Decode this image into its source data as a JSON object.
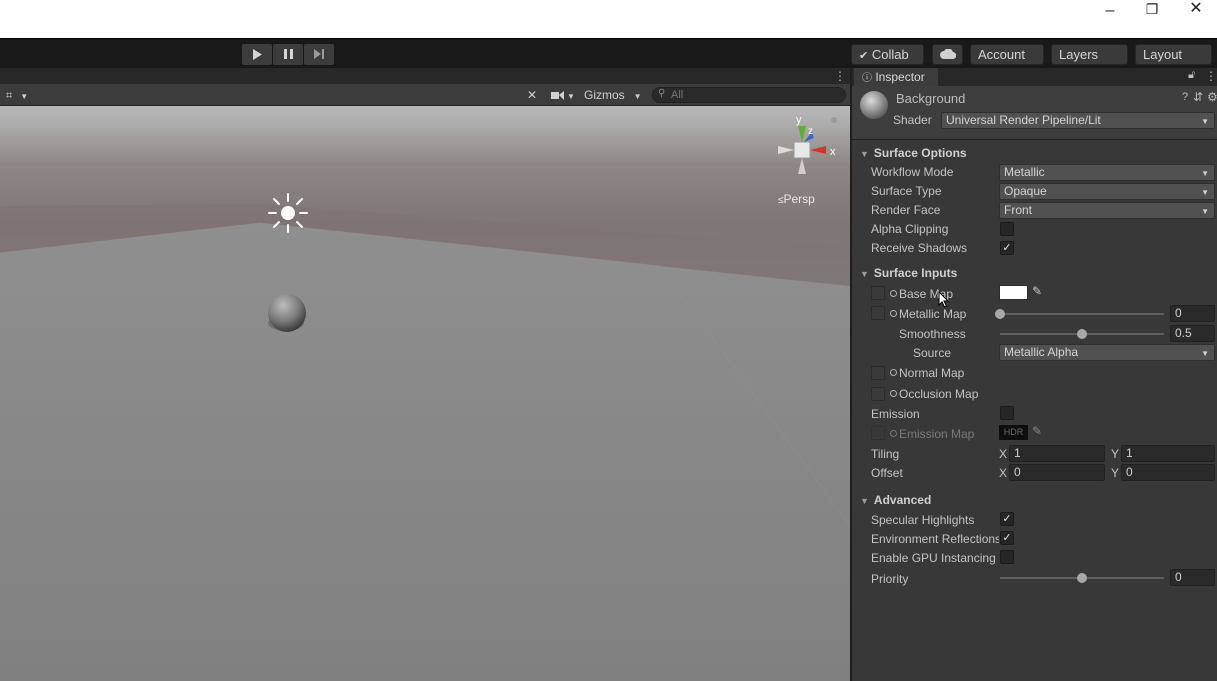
{
  "window_controls": {
    "minimize": "–",
    "restore": "❐",
    "close": "✕"
  },
  "toolbar": {
    "collab_label": "Collab",
    "account_label": "Account",
    "layers_label": "Layers",
    "layout_label": "Layout"
  },
  "scene": {
    "toolbar": {
      "gizmos_label": "Gizmos",
      "search_placeholder": "All"
    },
    "persp_label": "Persp",
    "gizmo_axes": {
      "y": "y",
      "z": "z",
      "x": "x"
    }
  },
  "inspector": {
    "tab_label": "Inspector",
    "material_name": "Background",
    "shader_label": "Shader",
    "shader_value": "Universal Render Pipeline/Lit",
    "surface_options": {
      "title": "Surface Options",
      "workflow_mode_label": "Workflow Mode",
      "workflow_mode_value": "Metallic",
      "surface_type_label": "Surface Type",
      "surface_type_value": "Opaque",
      "render_face_label": "Render Face",
      "render_face_value": "Front",
      "alpha_clipping_label": "Alpha Clipping",
      "alpha_clipping_checked": false,
      "receive_shadows_label": "Receive Shadows",
      "receive_shadows_checked": true
    },
    "surface_inputs": {
      "title": "Surface Inputs",
      "base_map_label": "Base Map",
      "base_map_color": "#ffffff",
      "metallic_map_label": "Metallic Map",
      "metallic_value": "0",
      "metallic_fraction": 0,
      "smoothness_label": "Smoothness",
      "smoothness_value": "0.5",
      "smoothness_fraction": 0.5,
      "source_label": "Source",
      "source_value": "Metallic Alpha",
      "normal_map_label": "Normal Map",
      "occlusion_map_label": "Occlusion Map",
      "emission_label": "Emission",
      "emission_checked": false,
      "emission_map_label": "Emission Map",
      "emission_hdr_label": "HDR",
      "tiling_label": "Tiling",
      "tiling_x_label": "X",
      "tiling_x": "1",
      "tiling_y_label": "Y",
      "tiling_y": "1",
      "offset_label": "Offset",
      "offset_x_label": "X",
      "offset_x": "0",
      "offset_y_label": "Y",
      "offset_y": "0"
    },
    "advanced": {
      "title": "Advanced",
      "specular_label": "Specular Highlights",
      "specular_checked": true,
      "env_reflections_label": "Environment Reflections",
      "env_reflections_checked": true,
      "gpu_instancing_label": "Enable GPU Instancing",
      "gpu_instancing_checked": false,
      "priority_label": "Priority",
      "priority_value": "0",
      "priority_fraction": 0.5
    }
  }
}
